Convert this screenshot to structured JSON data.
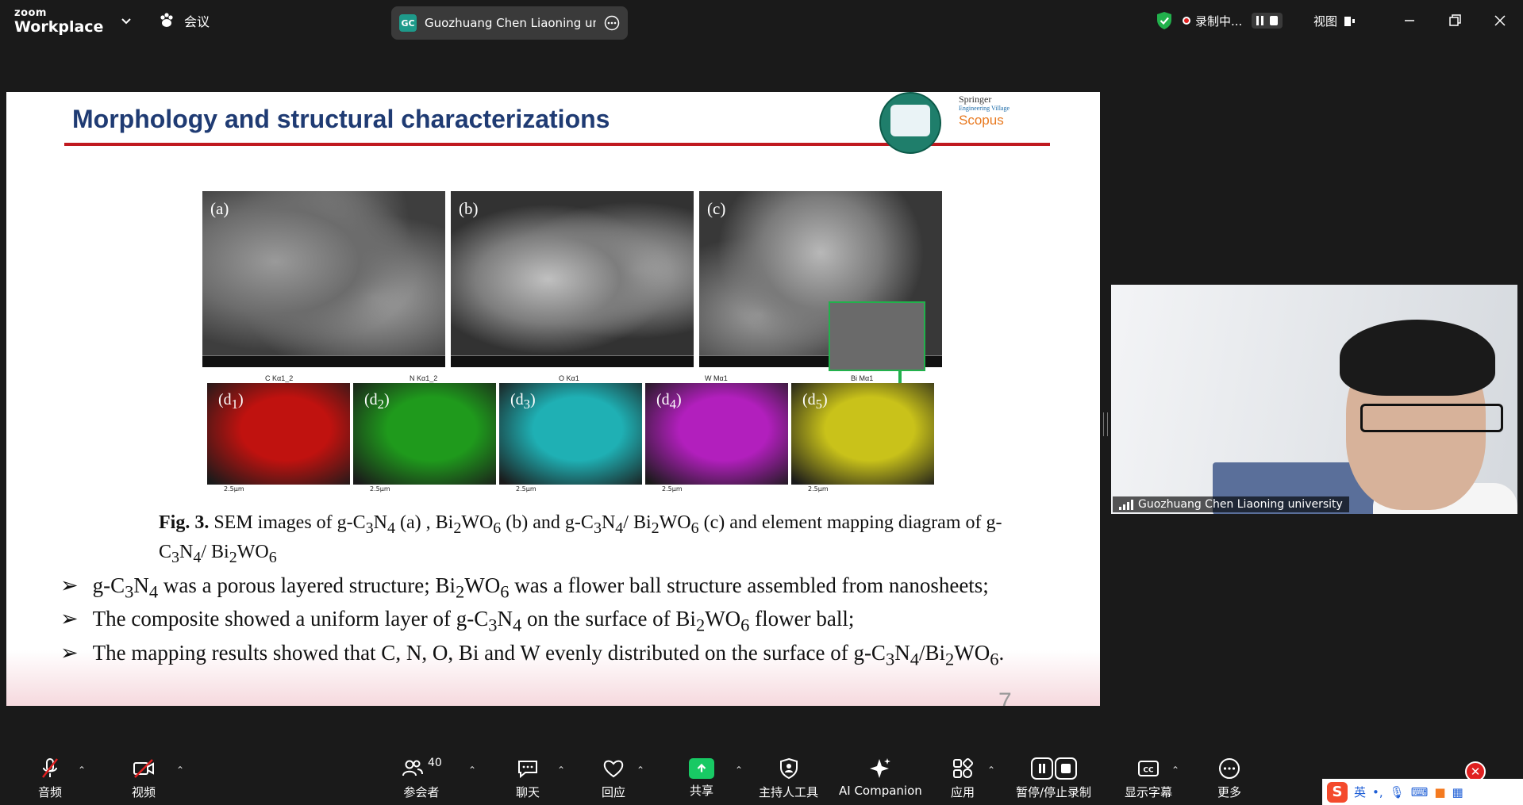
{
  "app": {
    "logo_small": "zoom",
    "logo_big": "Workplace",
    "meeting_label": "会议",
    "participant_pill": "Guozhuang Chen Liaoning univer:",
    "participant_initials": "GC",
    "recording_label": "录制中...",
    "view_label": "视图"
  },
  "slide": {
    "title": "Morphology and structural characterizations",
    "publishers": {
      "springer": "Springer",
      "engineering_village": "Engineering Village",
      "scopus": "Scopus"
    },
    "panels": [
      {
        "label": "(a)"
      },
      {
        "label": "(b)"
      },
      {
        "label": "(c)"
      }
    ],
    "maps": [
      {
        "title": "C Kα1_2",
        "sub": "(d1)",
        "scale": "2.5μm",
        "color": "#c0120f"
      },
      {
        "title": "N Kα1_2",
        "sub": "(d2)",
        "scale": "2.5μm",
        "color": "#1f9a1c"
      },
      {
        "title": "O Kα1",
        "sub": "(d3)",
        "scale": "2.5μm",
        "color": "#1fb0b4"
      },
      {
        "title": "W Mα1",
        "sub": "(d4)",
        "scale": "2.5μm",
        "color": "#b21fbd"
      },
      {
        "title": "Bi Mα1",
        "sub": "(d5)",
        "scale": "2.5μm",
        "color": "#c9c21a"
      }
    ],
    "caption_bold": "Fig. 3.",
    "caption_rest": "SEM images of g-C3N4 (a) , Bi2WO6 (b) and g-C3N4/ Bi2WO6 (c) and element mapping diagram of g-C3N4/ Bi2WO6",
    "bullets": [
      "g-C3N4 was a porous layered structure; Bi2WO6 was a flower ball structure assembled from nanosheets;",
      "The composite showed a uniform layer of g-C3N4 on the surface of Bi2WO6 flower ball;",
      "The mapping results showed that C, N, O, Bi and W evenly distributed on the surface of g-C3N4/Bi2WO6."
    ],
    "bullet_marker": "➢",
    "page_number": "7"
  },
  "video": {
    "participant_name": "Guozhuang Chen Liaoning university"
  },
  "toolbar": {
    "audio": "音频",
    "video": "视频",
    "participants": "参会者",
    "participant_count": "40",
    "chat": "聊天",
    "react": "回应",
    "share": "共享",
    "host_tools": "主持人工具",
    "ai_companion": "AI Companion",
    "apps": "应用",
    "pause_stop_recording": "暂停/停止录制",
    "captions": "显示字幕",
    "more": "更多"
  },
  "ime": {
    "lang": "英",
    "punct": "•,"
  }
}
